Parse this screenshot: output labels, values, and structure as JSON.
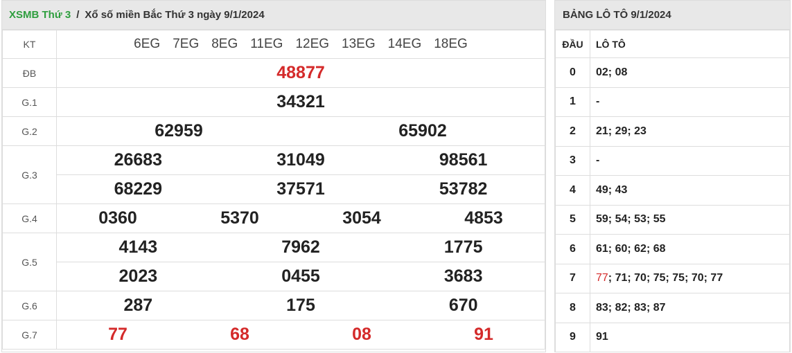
{
  "header": {
    "link": "XSMB Thứ 3",
    "sep": "/",
    "title": "Xổ số miền Bắc Thứ 3 ngày 9/1/2024"
  },
  "kt": {
    "label": "KT",
    "codes": [
      "6EG",
      "7EG",
      "8EG",
      "11EG",
      "12EG",
      "13EG",
      "14EG",
      "18EG"
    ]
  },
  "prizes": {
    "db": {
      "label": "ĐB",
      "values": [
        "48877"
      ]
    },
    "g1": {
      "label": "G.1",
      "values": [
        "34321"
      ]
    },
    "g2": {
      "label": "G.2",
      "values": [
        "62959",
        "65902"
      ]
    },
    "g3": {
      "label": "G.3",
      "values": [
        "26683",
        "31049",
        "98561",
        "68229",
        "37571",
        "53782"
      ]
    },
    "g4": {
      "label": "G.4",
      "values": [
        "0360",
        "5370",
        "3054",
        "4853"
      ]
    },
    "g5": {
      "label": "G.5",
      "values": [
        "4143",
        "7962",
        "1775",
        "2023",
        "0455",
        "3683"
      ]
    },
    "g6": {
      "label": "G.6",
      "values": [
        "287",
        "175",
        "670"
      ]
    },
    "g7": {
      "label": "G.7",
      "values": [
        "77",
        "68",
        "08",
        "91"
      ]
    }
  },
  "loto": {
    "title": "BẢNG LÔ TÔ 9/1/2024",
    "col_dau": "ĐẦU",
    "col_loto": "LÔ TÔ",
    "rows": [
      {
        "dau": "0",
        "val": "02; 08"
      },
      {
        "dau": "1",
        "val": "-"
      },
      {
        "dau": "2",
        "val": "21; 29; 23"
      },
      {
        "dau": "3",
        "val": "-"
      },
      {
        "dau": "4",
        "val": "49; 43"
      },
      {
        "dau": "5",
        "val": "59; 54; 53; 55"
      },
      {
        "dau": "6",
        "val": "61; 60; 62; 68"
      },
      {
        "dau": "7",
        "val_red": "77",
        "val": "; 71; 70; 75; 75; 70; 77"
      },
      {
        "dau": "8",
        "val": "83; 82; 83; 87"
      },
      {
        "dau": "9",
        "val": "91"
      }
    ]
  },
  "colors": {
    "accent": "#2e9e3e",
    "highlight": "#d42a2a"
  }
}
